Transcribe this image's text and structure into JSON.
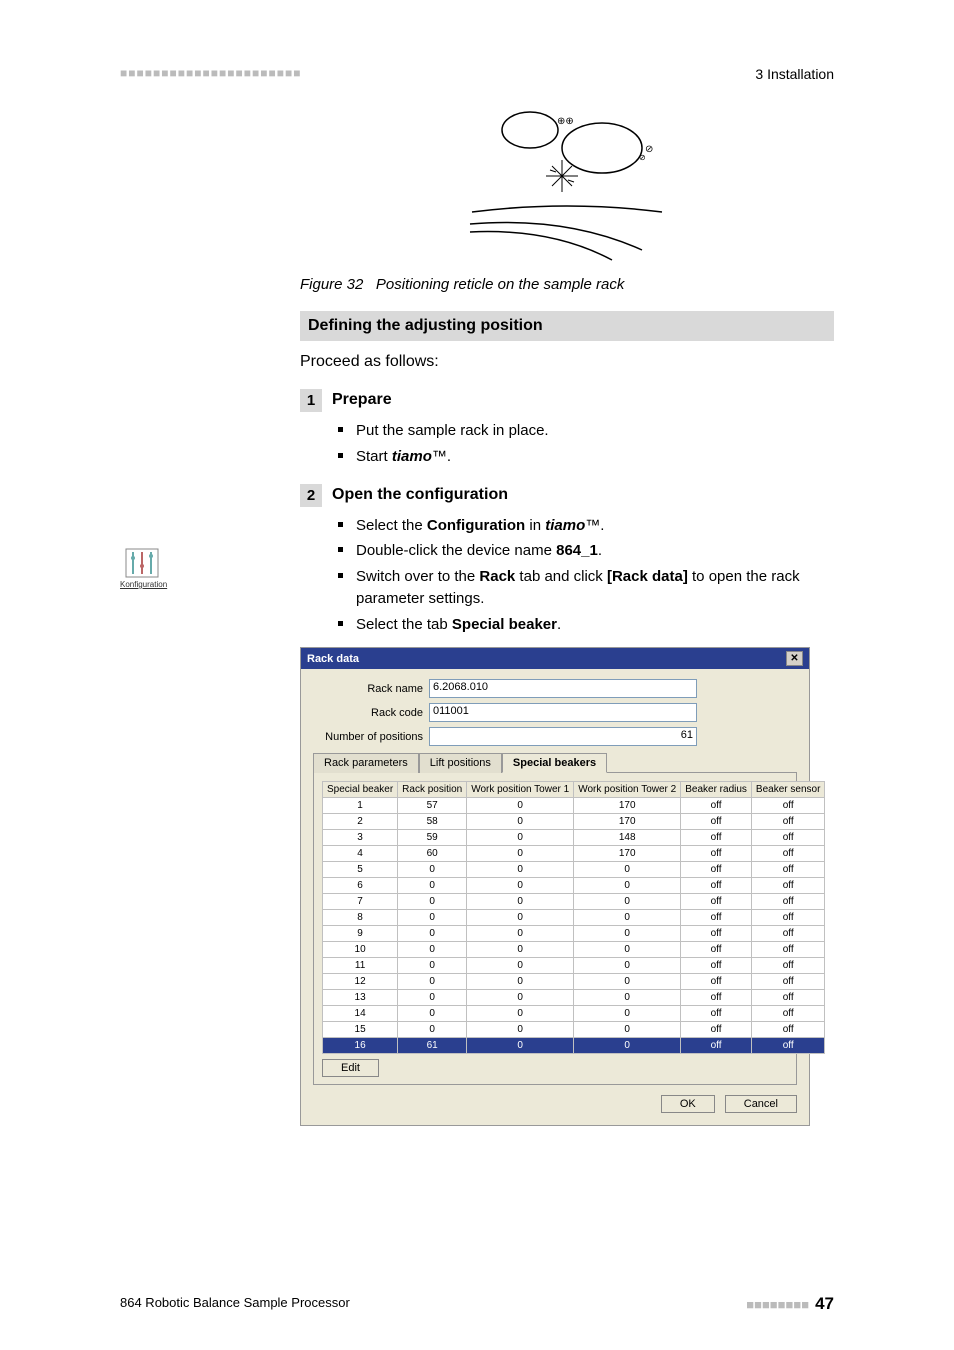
{
  "header": {
    "section": "3 Installation",
    "dots_left": "■■■■■■■■■■■■■■■■■■■■■■"
  },
  "figure": {
    "number": "Figure 32",
    "caption": "Positioning reticle on the sample rack"
  },
  "section_title": "Defining the adjusting position",
  "intro": "Proceed as follows:",
  "steps": {
    "s1": {
      "num": "1",
      "title": "Prepare",
      "items": [
        {
          "text": "Put the sample rack in place."
        },
        {
          "pre": "Start ",
          "em": "tiamo",
          "post": "™."
        }
      ]
    },
    "s2": {
      "num": "2",
      "title": "Open the configuration",
      "items": [
        {
          "pre": "Select the ",
          "b": "Configuration",
          "mid": " in ",
          "em": "tiamo",
          "post": "™."
        },
        {
          "pre": "Double-click the device name ",
          "b": "864_1",
          "post": "."
        },
        {
          "pre": "Switch over to the ",
          "b": "Rack",
          "mid": " tab and click ",
          "b2": "[Rack data]",
          "post": " to open the rack parameter settings."
        },
        {
          "pre": "Select the tab ",
          "b": "Special beaker",
          "post": "."
        }
      ]
    }
  },
  "side_icon_caption": "Konfiguration",
  "dialog": {
    "title": "Rack data",
    "rack_name_label": "Rack name",
    "rack_name_value": "6.2068.010",
    "rack_code_label": "Rack code",
    "rack_code_value": "011001",
    "num_pos_label": "Number of positions",
    "num_pos_value": "61",
    "tabs": {
      "t1": "Rack parameters",
      "t2": "Lift positions",
      "t3": "Special beakers"
    },
    "columns": [
      "Special beaker",
      "Rack position",
      "Work position Tower 1",
      "Work position Tower 2",
      "Beaker radius",
      "Beaker sensor"
    ],
    "rows": [
      [
        "1",
        "57",
        "0",
        "170",
        "off",
        "off"
      ],
      [
        "2",
        "58",
        "0",
        "170",
        "off",
        "off"
      ],
      [
        "3",
        "59",
        "0",
        "148",
        "off",
        "off"
      ],
      [
        "4",
        "60",
        "0",
        "170",
        "off",
        "off"
      ],
      [
        "5",
        "0",
        "0",
        "0",
        "off",
        "off"
      ],
      [
        "6",
        "0",
        "0",
        "0",
        "off",
        "off"
      ],
      [
        "7",
        "0",
        "0",
        "0",
        "off",
        "off"
      ],
      [
        "8",
        "0",
        "0",
        "0",
        "off",
        "off"
      ],
      [
        "9",
        "0",
        "0",
        "0",
        "off",
        "off"
      ],
      [
        "10",
        "0",
        "0",
        "0",
        "off",
        "off"
      ],
      [
        "11",
        "0",
        "0",
        "0",
        "off",
        "off"
      ],
      [
        "12",
        "0",
        "0",
        "0",
        "off",
        "off"
      ],
      [
        "13",
        "0",
        "0",
        "0",
        "off",
        "off"
      ],
      [
        "14",
        "0",
        "0",
        "0",
        "off",
        "off"
      ],
      [
        "15",
        "0",
        "0",
        "0",
        "off",
        "off"
      ],
      [
        "16",
        "61",
        "0",
        "0",
        "off",
        "off"
      ]
    ],
    "edit_btn": "Edit",
    "ok_btn": "OK",
    "cancel_btn": "Cancel"
  },
  "footer": {
    "left": "864 Robotic Balance Sample Processor",
    "dots": "■■■■■■■■",
    "page": "47"
  }
}
